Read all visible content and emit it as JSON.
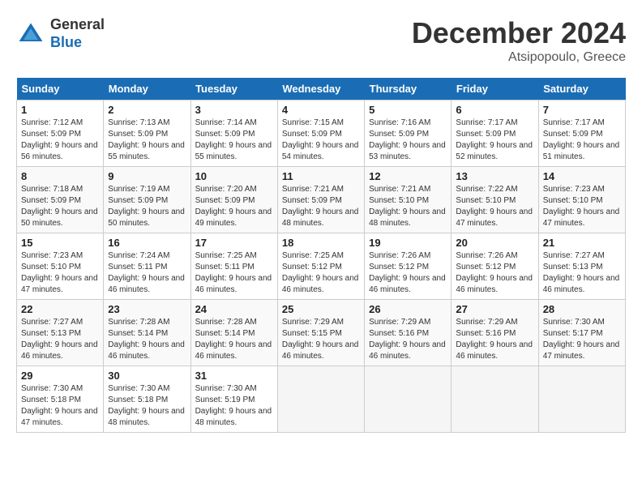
{
  "header": {
    "logo_general": "General",
    "logo_blue": "Blue",
    "month_title": "December 2024",
    "location": "Atsipopoulo, Greece"
  },
  "days_of_week": [
    "Sunday",
    "Monday",
    "Tuesday",
    "Wednesday",
    "Thursday",
    "Friday",
    "Saturday"
  ],
  "weeks": [
    [
      {
        "day": 1,
        "sunrise": "7:12 AM",
        "sunset": "5:09 PM",
        "daylight": "9 hours and 56 minutes."
      },
      {
        "day": 2,
        "sunrise": "7:13 AM",
        "sunset": "5:09 PM",
        "daylight": "9 hours and 55 minutes."
      },
      {
        "day": 3,
        "sunrise": "7:14 AM",
        "sunset": "5:09 PM",
        "daylight": "9 hours and 55 minutes."
      },
      {
        "day": 4,
        "sunrise": "7:15 AM",
        "sunset": "5:09 PM",
        "daylight": "9 hours and 54 minutes."
      },
      {
        "day": 5,
        "sunrise": "7:16 AM",
        "sunset": "5:09 PM",
        "daylight": "9 hours and 53 minutes."
      },
      {
        "day": 6,
        "sunrise": "7:17 AM",
        "sunset": "5:09 PM",
        "daylight": "9 hours and 52 minutes."
      },
      {
        "day": 7,
        "sunrise": "7:17 AM",
        "sunset": "5:09 PM",
        "daylight": "9 hours and 51 minutes."
      }
    ],
    [
      {
        "day": 8,
        "sunrise": "7:18 AM",
        "sunset": "5:09 PM",
        "daylight": "9 hours and 50 minutes."
      },
      {
        "day": 9,
        "sunrise": "7:19 AM",
        "sunset": "5:09 PM",
        "daylight": "9 hours and 50 minutes."
      },
      {
        "day": 10,
        "sunrise": "7:20 AM",
        "sunset": "5:09 PM",
        "daylight": "9 hours and 49 minutes."
      },
      {
        "day": 11,
        "sunrise": "7:21 AM",
        "sunset": "5:09 PM",
        "daylight": "9 hours and 48 minutes."
      },
      {
        "day": 12,
        "sunrise": "7:21 AM",
        "sunset": "5:10 PM",
        "daylight": "9 hours and 48 minutes."
      },
      {
        "day": 13,
        "sunrise": "7:22 AM",
        "sunset": "5:10 PM",
        "daylight": "9 hours and 47 minutes."
      },
      {
        "day": 14,
        "sunrise": "7:23 AM",
        "sunset": "5:10 PM",
        "daylight": "9 hours and 47 minutes."
      }
    ],
    [
      {
        "day": 15,
        "sunrise": "7:23 AM",
        "sunset": "5:10 PM",
        "daylight": "9 hours and 47 minutes."
      },
      {
        "day": 16,
        "sunrise": "7:24 AM",
        "sunset": "5:11 PM",
        "daylight": "9 hours and 46 minutes."
      },
      {
        "day": 17,
        "sunrise": "7:25 AM",
        "sunset": "5:11 PM",
        "daylight": "9 hours and 46 minutes."
      },
      {
        "day": 18,
        "sunrise": "7:25 AM",
        "sunset": "5:12 PM",
        "daylight": "9 hours and 46 minutes."
      },
      {
        "day": 19,
        "sunrise": "7:26 AM",
        "sunset": "5:12 PM",
        "daylight": "9 hours and 46 minutes."
      },
      {
        "day": 20,
        "sunrise": "7:26 AM",
        "sunset": "5:12 PM",
        "daylight": "9 hours and 46 minutes."
      },
      {
        "day": 21,
        "sunrise": "7:27 AM",
        "sunset": "5:13 PM",
        "daylight": "9 hours and 46 minutes."
      }
    ],
    [
      {
        "day": 22,
        "sunrise": "7:27 AM",
        "sunset": "5:13 PM",
        "daylight": "9 hours and 46 minutes."
      },
      {
        "day": 23,
        "sunrise": "7:28 AM",
        "sunset": "5:14 PM",
        "daylight": "9 hours and 46 minutes."
      },
      {
        "day": 24,
        "sunrise": "7:28 AM",
        "sunset": "5:14 PM",
        "daylight": "9 hours and 46 minutes."
      },
      {
        "day": 25,
        "sunrise": "7:29 AM",
        "sunset": "5:15 PM",
        "daylight": "9 hours and 46 minutes."
      },
      {
        "day": 26,
        "sunrise": "7:29 AM",
        "sunset": "5:16 PM",
        "daylight": "9 hours and 46 minutes."
      },
      {
        "day": 27,
        "sunrise": "7:29 AM",
        "sunset": "5:16 PM",
        "daylight": "9 hours and 46 minutes."
      },
      {
        "day": 28,
        "sunrise": "7:30 AM",
        "sunset": "5:17 PM",
        "daylight": "9 hours and 47 minutes."
      }
    ],
    [
      {
        "day": 29,
        "sunrise": "7:30 AM",
        "sunset": "5:18 PM",
        "daylight": "9 hours and 47 minutes."
      },
      {
        "day": 30,
        "sunrise": "7:30 AM",
        "sunset": "5:18 PM",
        "daylight": "9 hours and 48 minutes."
      },
      {
        "day": 31,
        "sunrise": "7:30 AM",
        "sunset": "5:19 PM",
        "daylight": "9 hours and 48 minutes."
      },
      null,
      null,
      null,
      null
    ]
  ],
  "labels": {
    "sunrise": "Sunrise:",
    "sunset": "Sunset:",
    "daylight": "Daylight:"
  }
}
